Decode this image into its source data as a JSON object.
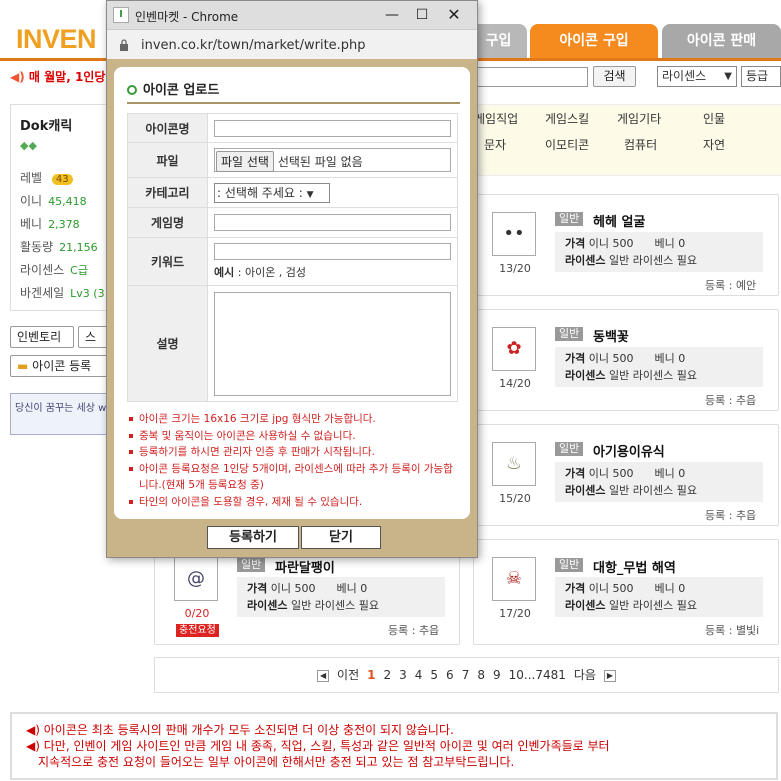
{
  "site": {
    "logo": "INVEN",
    "tabs": [
      "구입",
      "아이콘 구입",
      "아이콘 판매"
    ],
    "notice": "매 월말, 1인당",
    "search_button": "검색",
    "select1": "라이센스",
    "select2": "등급"
  },
  "profile": {
    "name": "Dok캐릭",
    "rows": [
      {
        "label": "레벨",
        "value": "43"
      },
      {
        "label": "이니",
        "value": "45,418"
      },
      {
        "label": "베니",
        "value": "2,378"
      },
      {
        "label": "활동량",
        "value": "21,156"
      },
      {
        "label": "라이센스",
        "value": "C급"
      },
      {
        "label": "바겐세일",
        "value": "Lv3 (3"
      }
    ],
    "buttons": [
      "인벤토리",
      "스",
      "아이콘 등록"
    ],
    "banner": "당신이 꿈꾸는 세상 www.inven.co"
  },
  "categories": {
    "row1": [
      "게임직업",
      "게임스킬",
      "게임기타",
      "인물"
    ],
    "row2": [
      "문자",
      "이모티콘",
      "컴퓨터",
      "자연"
    ]
  },
  "items": [
    {
      "badge": "일반",
      "name": "헤헤 얼굴",
      "count": "13/20",
      "price": "이니 500",
      "beni": "베니 0",
      "license": "일반 라이센스 필요",
      "reg": "등록 : 예안",
      "icon": "face-icon"
    },
    {
      "badge": "일반",
      "name": "동백꽃",
      "count": "14/20",
      "price": "이니 500",
      "beni": "베니 0",
      "license": "일반 라이센스 필요",
      "reg": "등록 : 추읍",
      "icon": "flower-icon"
    },
    {
      "badge": "일반",
      "name": "아기용이유식",
      "count": "15/20",
      "price": "이니 500",
      "beni": "베니 0",
      "license": "일반 라이센스 필요",
      "reg": "등록 : 추읍",
      "icon": "baby-food-icon"
    },
    {
      "badge": "일반",
      "name": "파란달팽이",
      "count": "0/20",
      "price": "이니 500",
      "beni": "베니 0",
      "license": "일반 라이센스 필요",
      "reg": "등록 : 추읍",
      "icon": "snail-icon",
      "charge": "충전요청"
    },
    {
      "badge": "일반",
      "name": "대항_무법 해역",
      "count": "17/20",
      "price": "이니 500",
      "beni": "베니 0",
      "license": "일반 라이센스 필요",
      "reg": "등록 : 별빛i",
      "icon": "skull-icon"
    }
  ],
  "item_labels": {
    "price": "가격",
    "license": "라이센스"
  },
  "pager": {
    "prev": "이전",
    "pages": [
      "1",
      "2",
      "3",
      "4",
      "5",
      "6",
      "7",
      "8",
      "9",
      "10...7481"
    ],
    "next": "다음"
  },
  "footnotes": [
    "아이콘은 최초 등록시의 판매 개수가 모두 소진되면 더 이상 충전이 되지 않습니다.",
    "다만, 인벤이 게임 사이트인 만큼 게임 내 종족, 직업, 스킬, 특성과 같은 일반적 아이콘 및 여러 인벤가족들로 부터",
    "지속적으로 충전 요청이 들어오는 일부 아이콘에 한해서만 충전 되고 있는 점 참고부탁드립니다."
  ],
  "popup": {
    "window_title": "인벤마켓 - Chrome",
    "url": "inven.co.kr/town/market/write.php",
    "heading": "아이콘 업로드",
    "labels": {
      "icon_name": "아이콘명",
      "file": "파일",
      "category": "카테고리",
      "game_name": "게임명",
      "keyword": "키워드",
      "description": "설명"
    },
    "file_button": "파일 선택",
    "file_status": "선택된 파일 없음",
    "category_select": ": 선택해 주세요 :",
    "keyword_hint_label": "예시",
    "keyword_hint": " : 아이온 , 검성",
    "notes": [
      "아이콘 크기는 16x16 크기로 jpg 형식만 가능합니다.",
      "중복 및 움직이는 아이콘은 사용하실 수 없습니다.",
      "등록하기를 하시면 관리자 인증 후 판매가 시작됩니다.",
      "아이콘 등록요청은 1인당 5개이며, 라이센스에 따라 추가 등록이 가능합니다.(현재 5개 등록요청 중)",
      "타인의 아이콘을 도용할 경우, 제재 될 수 있습니다."
    ],
    "register_button": "등록하기",
    "close_button": "닫기"
  }
}
